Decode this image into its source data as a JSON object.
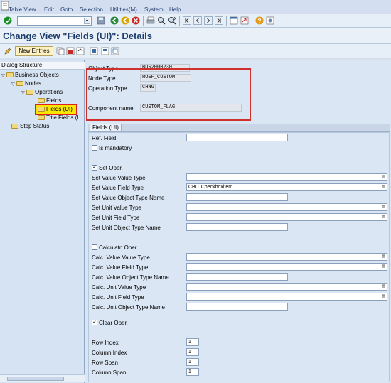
{
  "menu": {
    "items": [
      "Table View",
      "Edit",
      "Goto",
      "Selection",
      "Utilities(M)",
      "System",
      "Help"
    ]
  },
  "toolbar": {
    "icons": [
      "enter-icon",
      "back-icon",
      "exit-icon",
      "cancel-icon",
      "print-icon",
      "find-icon",
      "find-next-icon",
      "first-page-icon",
      "prev-page-icon",
      "next-page-icon",
      "last-page-icon",
      "new-session-icon",
      "shortcut-icon",
      "help-icon",
      "customize-icon"
    ]
  },
  "title": "Change View \"Fields (UI)\": Details",
  "app_toolbar": {
    "new_entries": "New Entries"
  },
  "dialog_structure": {
    "header": "Dialog Structure",
    "items": [
      {
        "label": "Business Objects"
      },
      {
        "label": "Nodes"
      },
      {
        "label": "Operations"
      },
      {
        "label": "Fields"
      },
      {
        "label": "Fields (UI)"
      },
      {
        "label": "Title Fields (L"
      },
      {
        "label": "Step Status"
      }
    ]
  },
  "header_fields": {
    "object_type_label": "Object Type",
    "object_type_value": "BUS2000230",
    "node_type_label": "Node Type",
    "node_type_value": "ROSF_CUSTOM",
    "operation_type_label": "Operation Type",
    "operation_type_value": "CHNG",
    "component_name_label": "Component name",
    "component_name_value": "CUSTOM_FLAG"
  },
  "fields_ui": {
    "tab_label": "Fields (UI)",
    "ref_field_label": "Ref. Field",
    "ref_field_value": "",
    "is_mandatory_label": "Is mandatory",
    "set_oper_label": "Set Oper.",
    "set_rows": [
      {
        "label": "Set Value Value Type",
        "value": "",
        "dropdown": true
      },
      {
        "label": "Set Value Field Type",
        "value": "CBIT Checkboxitem",
        "dropdown": true
      },
      {
        "label": "Set Value Object Type Name",
        "value": "",
        "dropdown": false
      },
      {
        "label": "Set Unit Value Type",
        "value": "",
        "dropdown": true
      },
      {
        "label": "Set Unit Field Type",
        "value": "",
        "dropdown": true
      },
      {
        "label": "Set Unit Object Type Name",
        "value": "",
        "dropdown": false
      }
    ],
    "calc_oper_label": "Calculatn Oper.",
    "calc_rows": [
      {
        "label": "Calc. Value Value Type",
        "value": "",
        "dropdown": true
      },
      {
        "label": "Calc. Value Field Type",
        "value": "",
        "dropdown": true
      },
      {
        "label": "Calc. Value Object Type Name",
        "value": "",
        "dropdown": false
      },
      {
        "label": "Calc. Unit Value Type",
        "value": "",
        "dropdown": true
      },
      {
        "label": "Calc. Unit Field Type",
        "value": "",
        "dropdown": true
      },
      {
        "label": "Calc. Unit Object Type Name",
        "value": "",
        "dropdown": false
      }
    ],
    "clear_oper_label": "Clear Oper.",
    "layout_rows": [
      {
        "label": "Row Index",
        "value": "1"
      },
      {
        "label": "Column Index",
        "value": "1"
      },
      {
        "label": "Row Span",
        "value": "1"
      },
      {
        "label": "Column Span",
        "value": "1"
      }
    ]
  },
  "colors": {
    "title": "#1c3d6e",
    "highlight_border": "#e0201c",
    "highlight_fill": "#f6e600"
  }
}
